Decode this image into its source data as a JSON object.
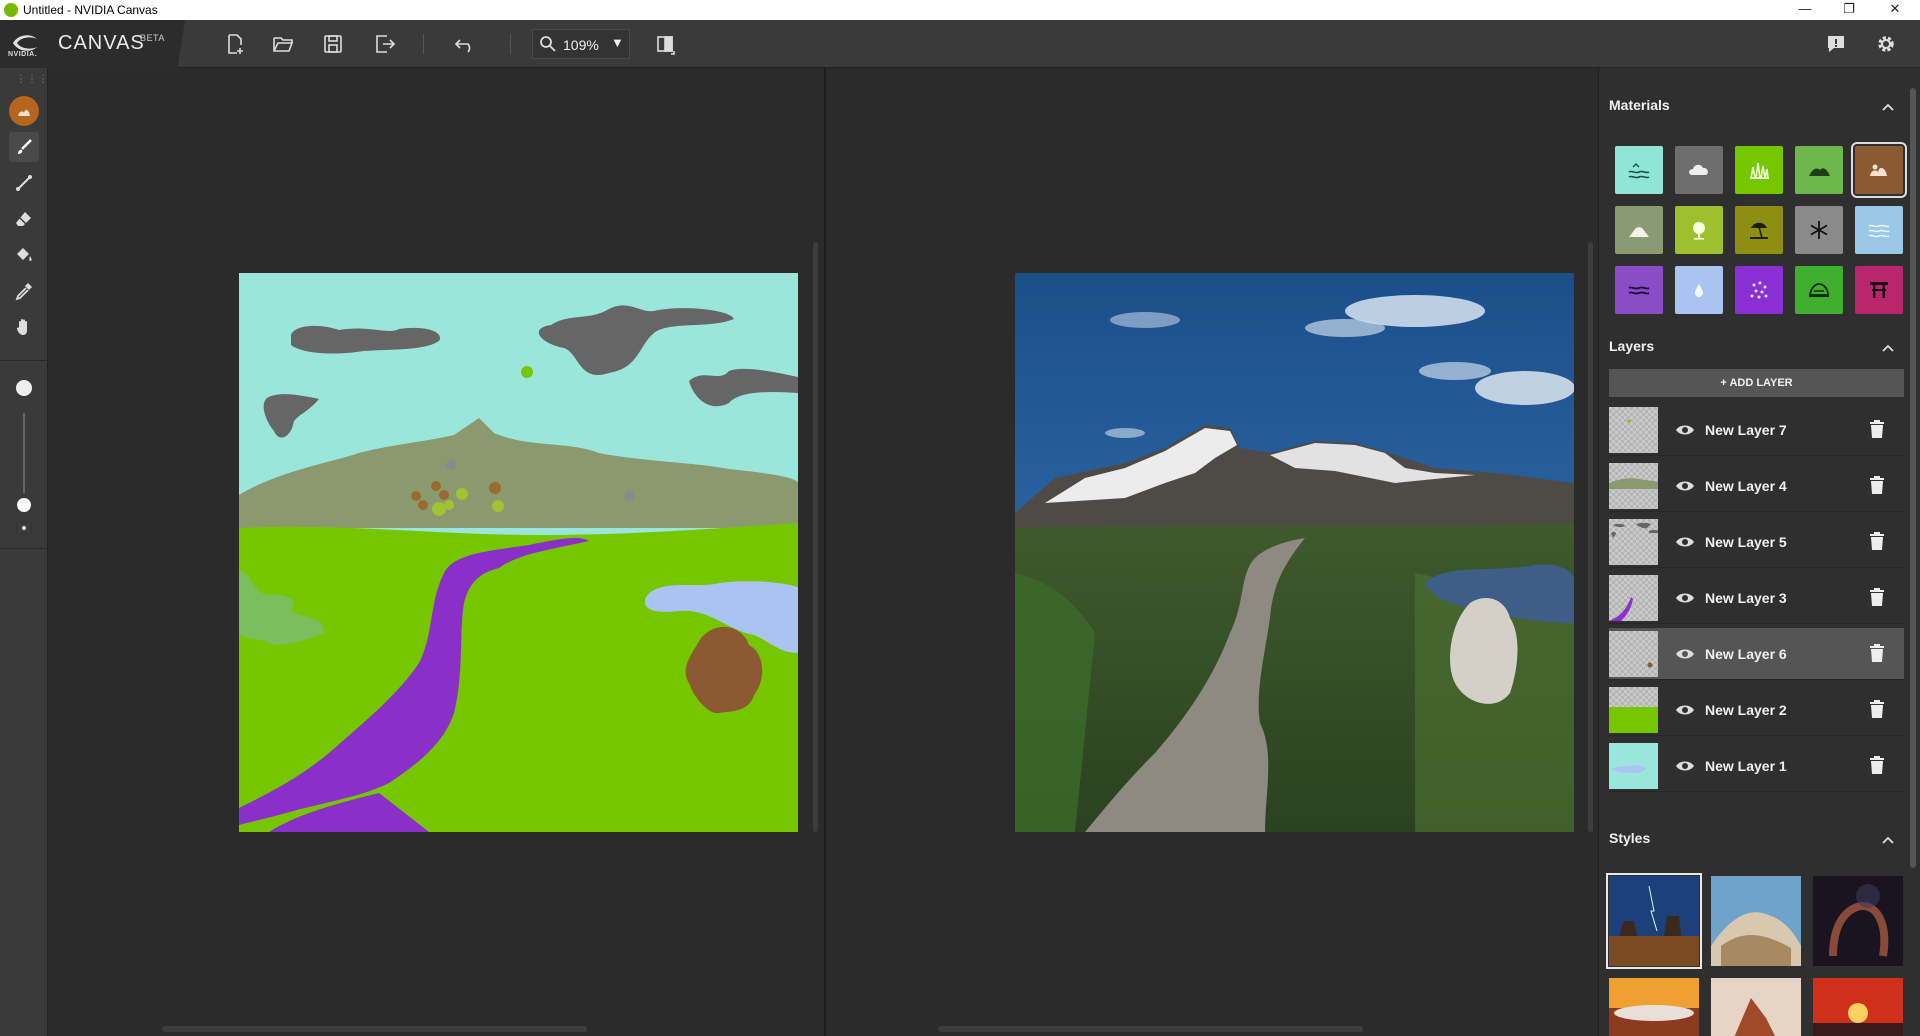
{
  "window": {
    "title": "Untitled - NVIDIA Canvas",
    "controls": {
      "minimize": "—",
      "restore": "❐",
      "close": "✕"
    }
  },
  "brand": {
    "logo_text": "NVIDIA.",
    "app_name": "CANVAS",
    "badge": "BETA"
  },
  "toolbar": {
    "zoom_value": "109%",
    "icons": [
      "new-file-icon",
      "open-folder-icon",
      "save-icon",
      "export-icon",
      "undo-icon",
      "zoom-icon",
      "compare-view-icon",
      "feedback-icon",
      "gear-icon"
    ]
  },
  "tools": [
    "material-brush",
    "brush",
    "line",
    "eraser",
    "paint-bucket",
    "eyedropper",
    "pan-hand",
    "brush-size"
  ],
  "materials": {
    "title": "Materials",
    "items": [
      {
        "name": "sea",
        "color": "#8fe5d6"
      },
      {
        "name": "cloud",
        "color": "#6e6e6e"
      },
      {
        "name": "grass",
        "color": "#76c600"
      },
      {
        "name": "hill",
        "color": "#6cb84a"
      },
      {
        "name": "dirt",
        "color": "#8b5a32",
        "selected": true
      },
      {
        "name": "mountain",
        "color": "#8a9a72"
      },
      {
        "name": "bush",
        "color": "#9ec02e"
      },
      {
        "name": "beach",
        "color": "#8c8f12"
      },
      {
        "name": "snow",
        "color": "#8a8a8a"
      },
      {
        "name": "water",
        "color": "#9cc8e8"
      },
      {
        "name": "river",
        "color": "#8a4cc7"
      },
      {
        "name": "fog",
        "color": "#aac4f2"
      },
      {
        "name": "flowers",
        "color": "#8a2fd4"
      },
      {
        "name": "rock",
        "color": "#3fae2c"
      },
      {
        "name": "building",
        "color": "#b9266e"
      }
    ]
  },
  "layers": {
    "title": "Layers",
    "add_label": "+ ADD LAYER",
    "items": [
      {
        "name": "New Layer 7"
      },
      {
        "name": "New Layer 4"
      },
      {
        "name": "New Layer 5"
      },
      {
        "name": "New Layer 3"
      },
      {
        "name": "New Layer 6",
        "selected": true
      },
      {
        "name": "New Layer 2"
      },
      {
        "name": "New Layer 1"
      }
    ]
  },
  "styles": {
    "title": "Styles"
  },
  "colors": {
    "panel_bg": "#2f2f2f",
    "toolbar_bg": "#3a3a3a",
    "accent_tool": "#b5651d",
    "nvidia_green": "#76b900"
  }
}
